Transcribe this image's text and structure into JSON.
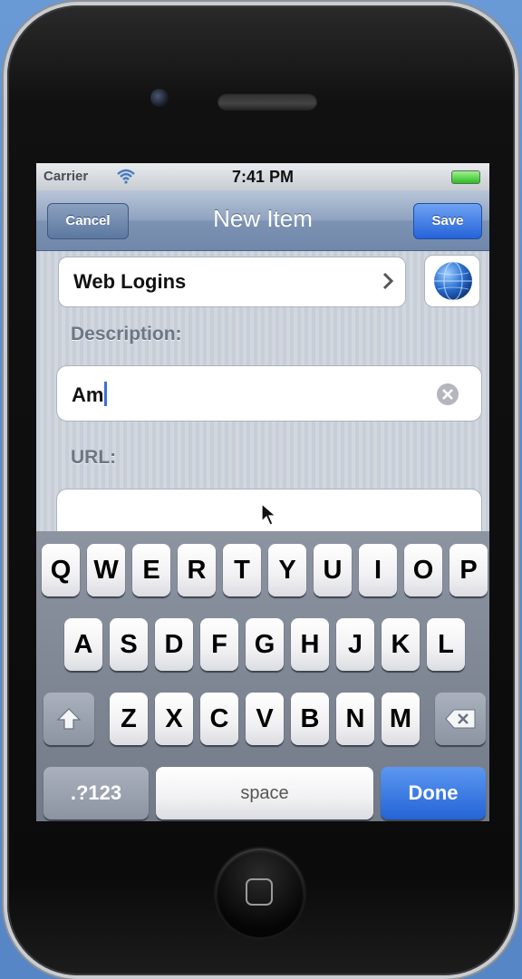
{
  "status_bar": {
    "carrier": "Carrier",
    "time": "7:41 PM",
    "wifi_icon": "wifi-icon",
    "battery_icon": "battery-icon"
  },
  "nav_bar": {
    "title": "New Item",
    "cancel_label": "Cancel",
    "save_label": "Save"
  },
  "form": {
    "category": {
      "value": "Web Logins",
      "chevron_icon": "chevron-right-icon",
      "globe_icon": "globe-icon"
    },
    "description": {
      "label": "Description:",
      "value": "Am",
      "clear_icon": "clear-icon"
    },
    "url": {
      "label": "URL:",
      "value": ""
    }
  },
  "keyboard": {
    "row1": [
      "Q",
      "W",
      "E",
      "R",
      "T",
      "Y",
      "U",
      "I",
      "O",
      "P"
    ],
    "row2": [
      "A",
      "S",
      "D",
      "F",
      "G",
      "H",
      "J",
      "K",
      "L"
    ],
    "row3": [
      "Z",
      "X",
      "C",
      "V",
      "B",
      "N",
      "M"
    ],
    "shift_icon": "shift-icon",
    "delete_icon": "delete-icon",
    "numbers_label": ".?123",
    "space_label": "space",
    "done_label": "Done"
  },
  "colors": {
    "nav_bar": "#7d93b3",
    "save_button": "#2563d8",
    "done_key": "#2464d6",
    "cursor": "#3c6fd8"
  }
}
